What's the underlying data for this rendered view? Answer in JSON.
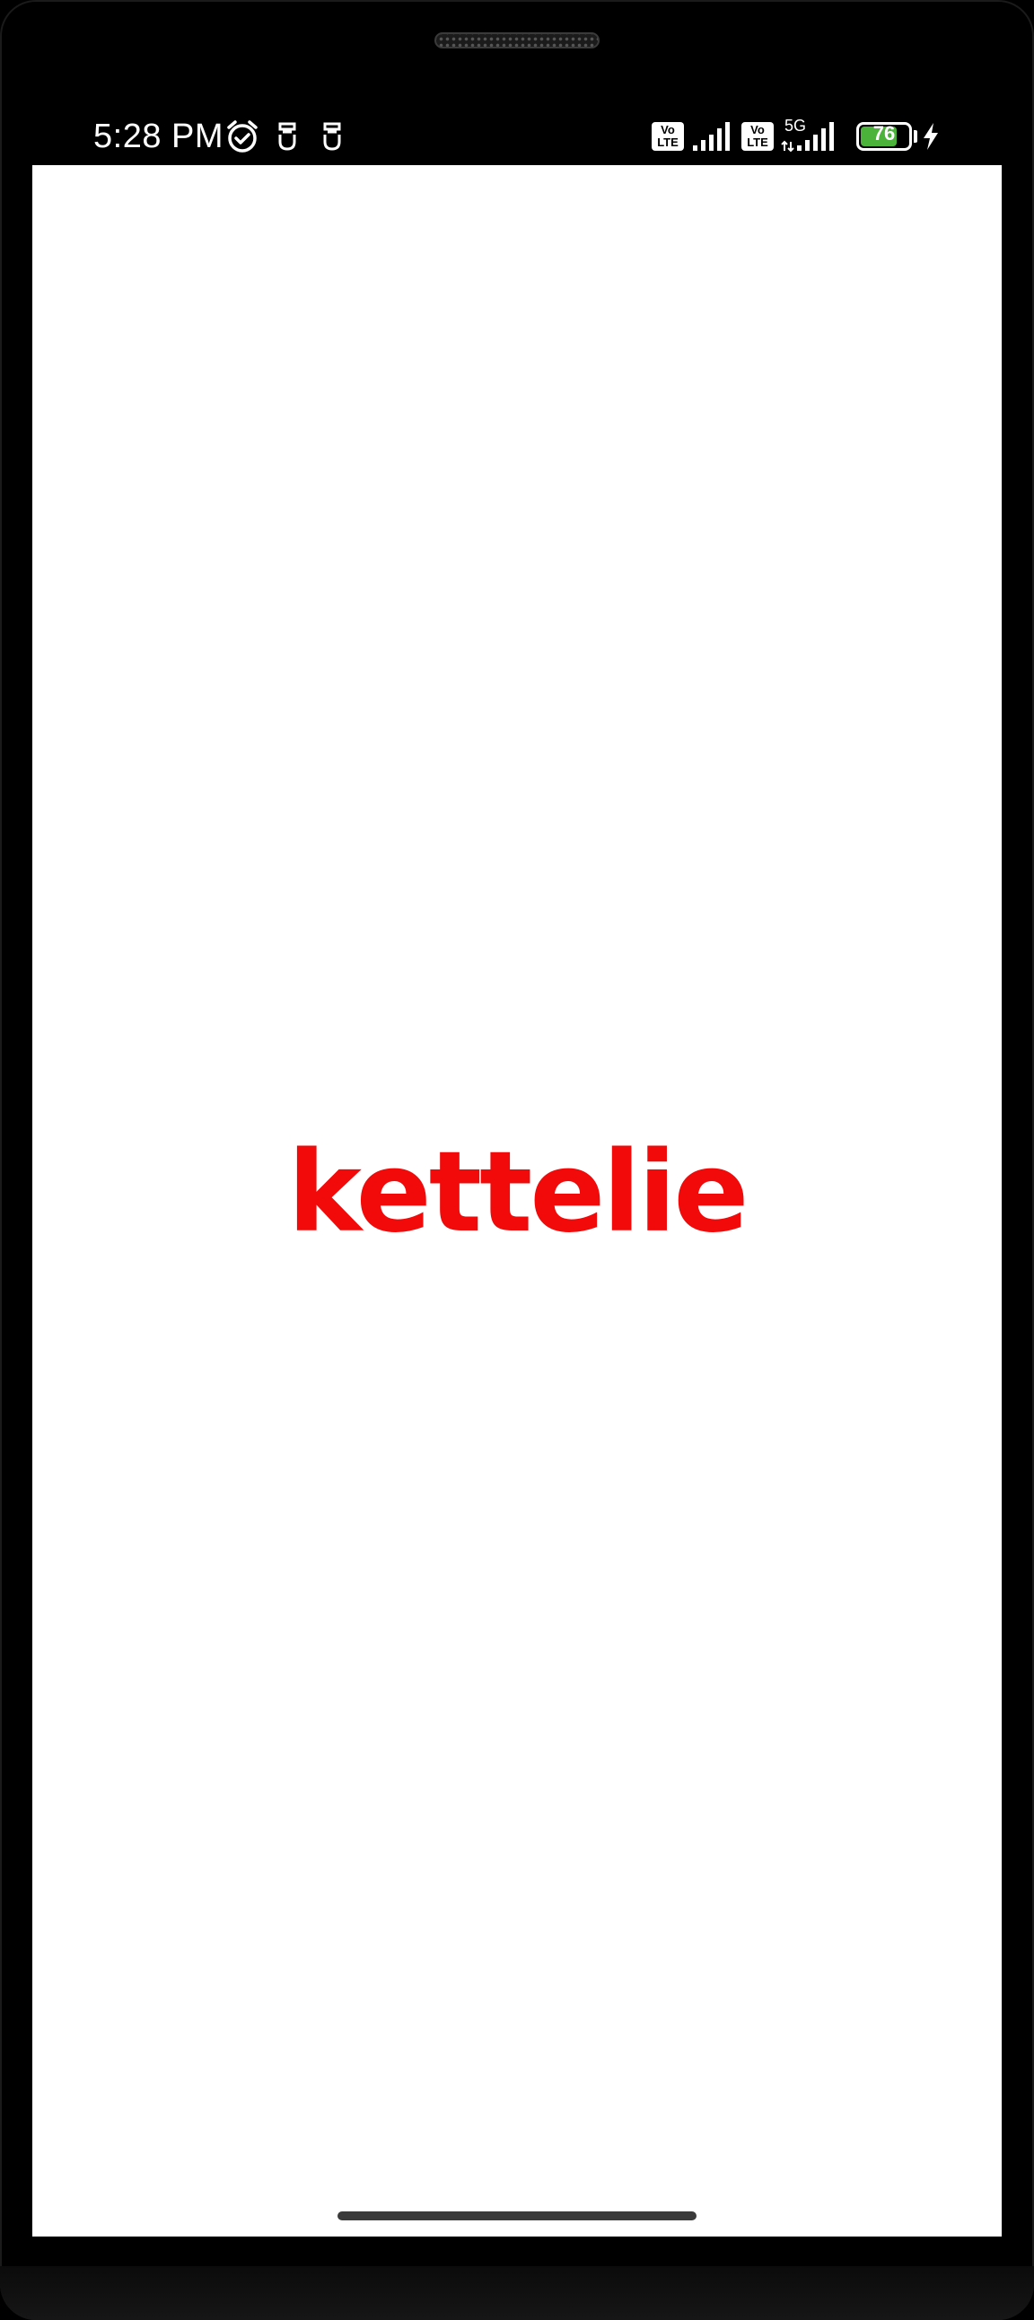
{
  "status_bar": {
    "time": "5:28 PM",
    "volte_1": "Vo\nLTE",
    "volte_2": "Vo\nLTE",
    "network_type": "5G",
    "battery_percent": "76",
    "battery_level": 0.76,
    "charging": true,
    "icons": [
      "alarm-icon",
      "notification-icon",
      "notification-icon",
      "volte-icon",
      "signal-icon",
      "volte-icon",
      "5g-signal-icon",
      "battery-icon",
      "charging-icon"
    ]
  },
  "splash": {
    "logo_text": "kettelie",
    "logo_color": "#f20a0a"
  }
}
